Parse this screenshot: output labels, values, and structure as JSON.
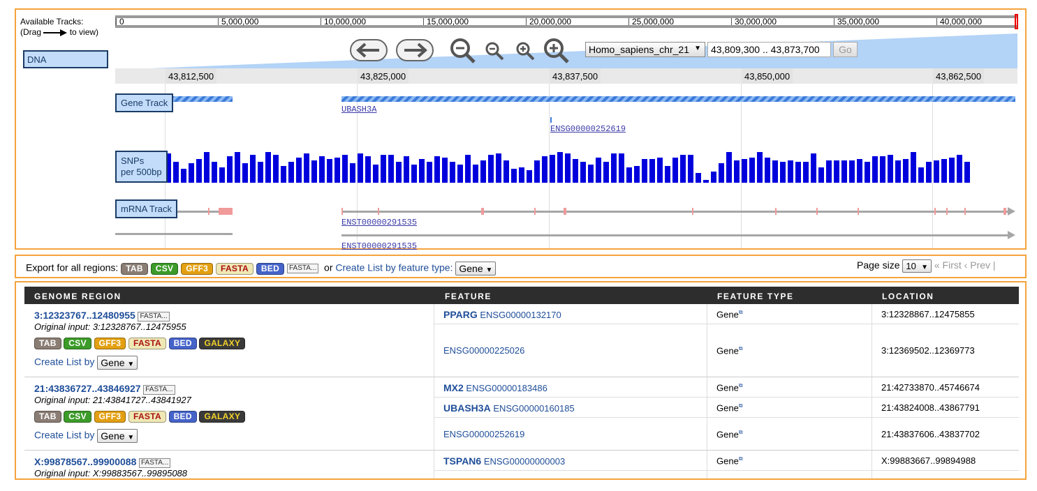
{
  "browser": {
    "available_tracks_line1": "Available Tracks:",
    "available_tracks_drag": "(Drag",
    "available_tracks_view": "to view)",
    "dna_track_label": "DNA",
    "overview_ticks": [
      "0",
      "5,000,000",
      "10,000,000",
      "15,000,000",
      "20,000,000",
      "25,000,000",
      "30,000,000",
      "35,000,000",
      "40,000,000"
    ],
    "chromosome_select": "Homo_sapiens_chr_21",
    "location_input": "43,809,300 .. 43,873,700",
    "go_button": "Go",
    "ruler_ticks": [
      "43,812,500",
      "43,825,000",
      "43,837,500",
      "43,850,000",
      "43,862,500"
    ],
    "gene_track_label": "Gene Track",
    "gene_feature_1": "UBASH3A",
    "gene_feature_2": "ENSG00000252619",
    "snp_track_label_1": "SNPs",
    "snp_track_label_2": "per 500bp",
    "mrna_track_label": "mRNA Track",
    "mrna_feature_1": "ENST00000291535",
    "mrna_feature_2": "ENST00000291535",
    "snp_colour": "#0000dd"
  },
  "export": {
    "label": "Export for all regions:",
    "formats": [
      "TAB",
      "CSV",
      "GFF3",
      "FASTA",
      "BED"
    ],
    "fasta_small": "FASTA...",
    "or_text": "or",
    "create_list_text": "Create List by feature type:",
    "feature_type_select": "Gene",
    "page_size_label": "Page size",
    "page_size_value": "10",
    "first_link": "« First",
    "prev_link": "‹ Prev",
    "sep": "|"
  },
  "table": {
    "headers": [
      "GENOME REGION",
      "FEATURE",
      "FEATURE TYPE",
      "LOCATION"
    ],
    "rows": [
      {
        "region": "3:12323767..12480955",
        "fasta": "FASTA...",
        "original_input": "Original input: 3:12328767..12475955",
        "formats": [
          "TAB",
          "CSV",
          "GFF3",
          "FASTA",
          "BED",
          "GALAXY"
        ],
        "create_list": "Create List by",
        "create_list_select": "Gene",
        "features": [
          {
            "name": "PPARG",
            "id": "ENSG00000132170",
            "type": "Gene",
            "location": "3:12328867..12475855"
          },
          {
            "name": "",
            "id": "ENSG00000225026",
            "type": "Gene",
            "location": "3:12369502..12369773"
          }
        ]
      },
      {
        "region": "21:43836727..43846927",
        "fasta": "FASTA...",
        "original_input": "Original input: 21:43841727..43841927",
        "formats": [
          "TAB",
          "CSV",
          "GFF3",
          "FASTA",
          "BED",
          "GALAXY"
        ],
        "create_list": "Create List by",
        "create_list_select": "Gene",
        "features": [
          {
            "name": "MX2",
            "id": "ENSG00000183486",
            "type": "Gene",
            "location": "21:42733870..45746674"
          },
          {
            "name": "UBASH3A",
            "id": "ENSG00000160185",
            "type": "Gene",
            "location": "21:43824008..43867791"
          },
          {
            "name": "",
            "id": "ENSG00000252619",
            "type": "Gene",
            "location": "21:43837606..43837702"
          }
        ]
      },
      {
        "region": "X:99878567..99900088",
        "fasta": "FASTA...",
        "original_input": "Original input: X:99883567..99895088",
        "features": [
          {
            "name": "TSPAN6",
            "id": "ENSG00000000003",
            "type": "Gene",
            "location": "X:99883667..99894988"
          }
        ]
      }
    ]
  }
}
